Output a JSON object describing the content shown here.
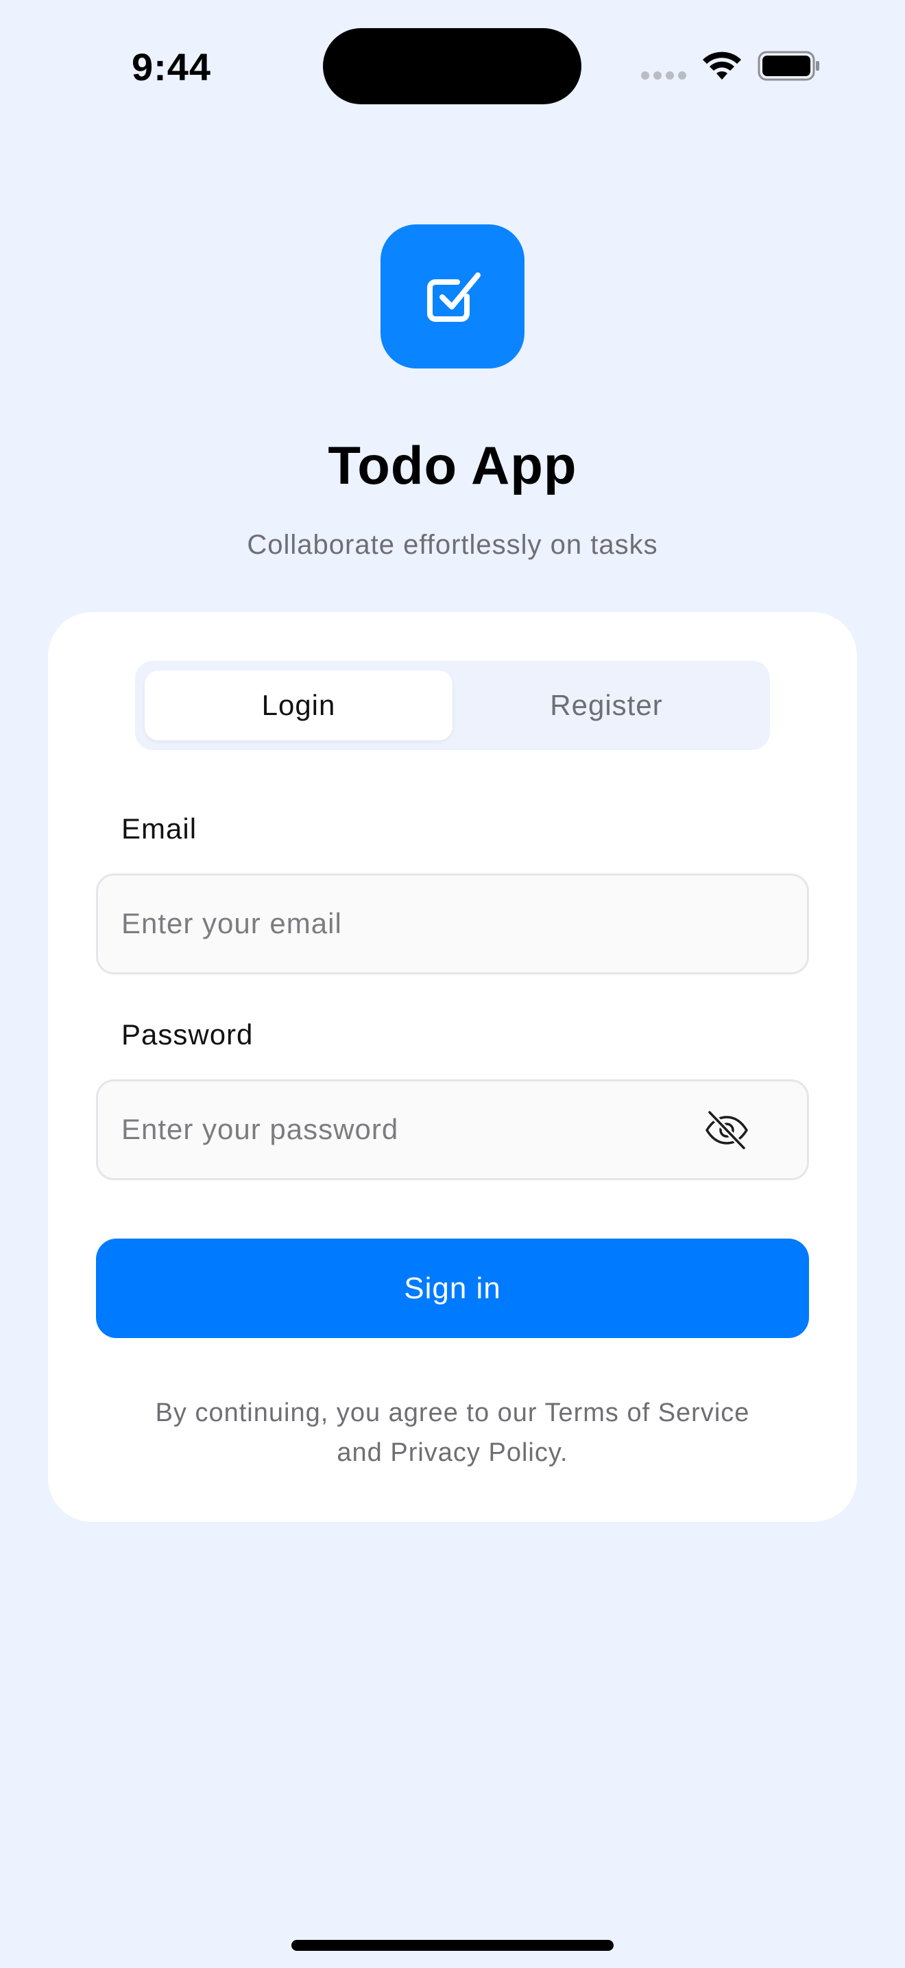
{
  "status_bar": {
    "time": "9:44"
  },
  "header": {
    "logo_icon": "checkbox-icon",
    "title": "Todo App",
    "subtitle": "Collaborate effortlessly on tasks"
  },
  "auth_tabs": {
    "login_label": "Login",
    "register_label": "Register",
    "selected": "Login"
  },
  "form": {
    "email": {
      "label": "Email",
      "placeholder": "Enter your email",
      "value": ""
    },
    "password": {
      "label": "Password",
      "placeholder": "Enter your password",
      "value": "",
      "visibility_icon": "eye-slash-icon"
    },
    "submit_label": "Sign in"
  },
  "footer": {
    "terms_text": "By continuing, you agree to our Terms of Service and Privacy Policy."
  },
  "colors": {
    "background": "#ecf2fe",
    "accent": "#007aff",
    "logo": "#0a84ff",
    "card": "#ffffff",
    "muted_text": "#6e6e73"
  }
}
